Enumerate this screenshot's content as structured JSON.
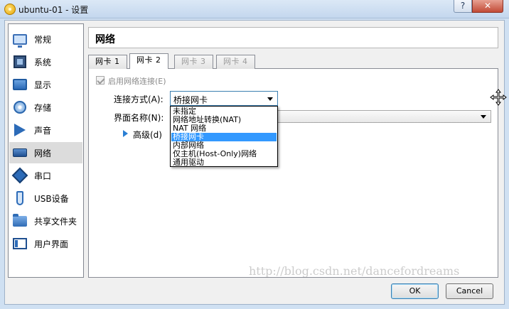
{
  "window": {
    "title": "ubuntu-01 - 设置",
    "help_label": "?",
    "close_label": "✕"
  },
  "sidebar": {
    "items": [
      {
        "label": "常规",
        "icon": "general-monitor-icon"
      },
      {
        "label": "系统",
        "icon": "system-chip-icon"
      },
      {
        "label": "显示",
        "icon": "display-icon"
      },
      {
        "label": "存储",
        "icon": "storage-disk-icon"
      },
      {
        "label": "声音",
        "icon": "audio-speaker-icon"
      },
      {
        "label": "网络",
        "icon": "network-card-icon",
        "selected": true
      },
      {
        "label": "串口",
        "icon": "serial-port-icon"
      },
      {
        "label": "USB设备",
        "icon": "usb-icon"
      },
      {
        "label": "共享文件夹",
        "icon": "shared-folder-icon"
      },
      {
        "label": "用户界面",
        "icon": "user-interface-icon"
      }
    ]
  },
  "header": {
    "title": "网络"
  },
  "tabs": [
    {
      "label": "网卡 1",
      "state": "normal"
    },
    {
      "label": "网卡 2",
      "state": "active"
    },
    {
      "label": "网卡 3",
      "state": "disabled"
    },
    {
      "label": "网卡 4",
      "state": "disabled"
    }
  ],
  "adapter": {
    "enable_label": "启用网络连接(E)",
    "enable_checked": true,
    "attached_label": "连接方式(A):",
    "attached_value": "桥接网卡",
    "name_label": "界面名称(N):",
    "advanced_label": "高级(d)"
  },
  "dropdown": {
    "options": [
      "未指定",
      "网络地址转换(NAT)",
      "NAT 网络",
      "桥接网卡",
      "内部网络",
      "仅主机(Host-Only)网络",
      "通用驱动"
    ],
    "selected_index": 3
  },
  "buttons": {
    "ok": "OK",
    "cancel": "Cancel"
  },
  "watermark": "http://blog.csdn.net/dancefordreams"
}
